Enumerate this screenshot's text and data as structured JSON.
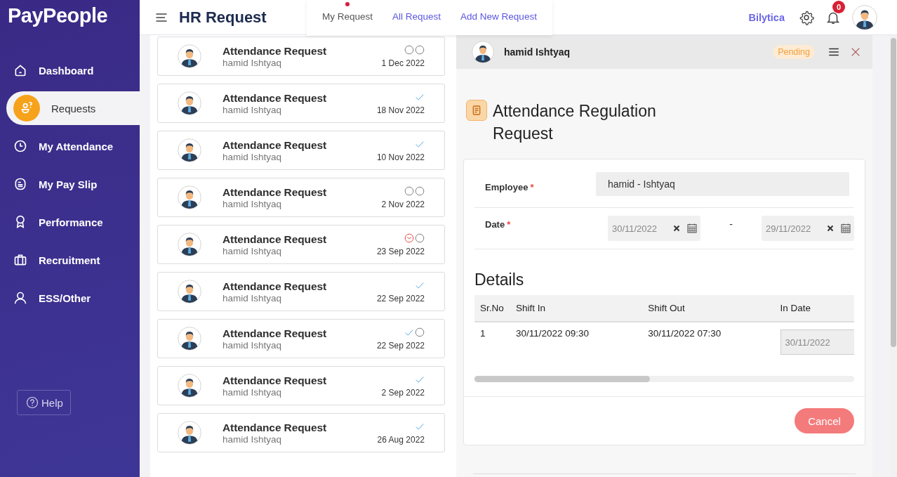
{
  "sidebar": {
    "logo": "PayPeople",
    "items": [
      {
        "label": "Dashboard",
        "selected": false
      },
      {
        "label": "Requests",
        "selected": true
      },
      {
        "label": "My Attendance",
        "selected": false
      },
      {
        "label": "My Pay Slip",
        "selected": false
      },
      {
        "label": "Performance",
        "selected": false
      },
      {
        "label": "Recruitment",
        "selected": false
      },
      {
        "label": "ESS/Other",
        "selected": false
      }
    ],
    "help": "Help"
  },
  "header": {
    "title": "HR Request",
    "tabs": [
      {
        "label": "My Request",
        "selected": true
      },
      {
        "label": "All Request",
        "selected": false
      },
      {
        "label": "Add New Request",
        "selected": false
      }
    ],
    "company": "Bilytica",
    "notifications": "0"
  },
  "requests": [
    {
      "title": "Attendance Request",
      "employee": "hamid Ishtyaq",
      "date": "1 Dec 2022",
      "steps": [
        {
          "kind": "circle"
        },
        {
          "kind": "circle"
        }
      ]
    },
    {
      "title": "Attendance Request",
      "employee": "hamid Ishtyaq",
      "date": "18 Nov 2022",
      "steps": [
        {
          "kind": "check"
        }
      ]
    },
    {
      "title": "Attendance Request",
      "employee": "hamid Ishtyaq",
      "date": "10 Nov 2022",
      "steps": [
        {
          "kind": "check"
        }
      ]
    },
    {
      "title": "Attendance Request",
      "employee": "hamid Ishtyaq",
      "date": "2 Nov 2022",
      "steps": [
        {
          "kind": "circle"
        },
        {
          "kind": "circle"
        }
      ]
    },
    {
      "title": "Attendance Request",
      "employee": "hamid Ishtyaq",
      "date": "23 Sep 2022",
      "steps": [
        {
          "kind": "clock"
        },
        {
          "kind": "circle"
        }
      ]
    },
    {
      "title": "Attendance Request",
      "employee": "hamid Ishtyaq",
      "date": "22 Sep 2022",
      "steps": [
        {
          "kind": "check"
        }
      ]
    },
    {
      "title": "Attendance Request",
      "employee": "hamid Ishtyaq",
      "date": "22 Sep 2022",
      "steps": [
        {
          "kind": "check"
        },
        {
          "kind": "circle"
        }
      ]
    },
    {
      "title": "Attendance Request",
      "employee": "hamid Ishtyaq",
      "date": "2 Sep 2022",
      "steps": [
        {
          "kind": "check"
        }
      ]
    },
    {
      "title": "Attendance Request",
      "employee": "hamid Ishtyaq",
      "date": "26 Aug 2022",
      "steps": [
        {
          "kind": "check"
        }
      ]
    }
  ],
  "detail": {
    "employee": "hamid Ishtyaq",
    "status": "Pending",
    "title": "Attendance Regulation Request",
    "fields": [
      {
        "kind": "text",
        "label": "Employee",
        "required_mark": "*",
        "value": "hamid - Ishtyaq"
      },
      {
        "kind": "date_range",
        "label": "Date",
        "required_mark": "*",
        "from": "30/11/2022",
        "separator": "-",
        "to": "29/11/2022"
      }
    ],
    "details_heading": "Details",
    "table": {
      "columns": [
        {
          "label": "Sr.No",
          "kind": "text"
        },
        {
          "label": "Shift In",
          "kind": "text"
        },
        {
          "label": "Shift Out",
          "kind": "text"
        },
        {
          "label": "In Date",
          "kind": "date"
        }
      ],
      "rows": [
        [
          "1",
          "30/11/2022 09:30",
          "30/11/2022 07:30",
          "30/11/2022"
        ]
      ]
    },
    "cancel": "Cancel"
  }
}
